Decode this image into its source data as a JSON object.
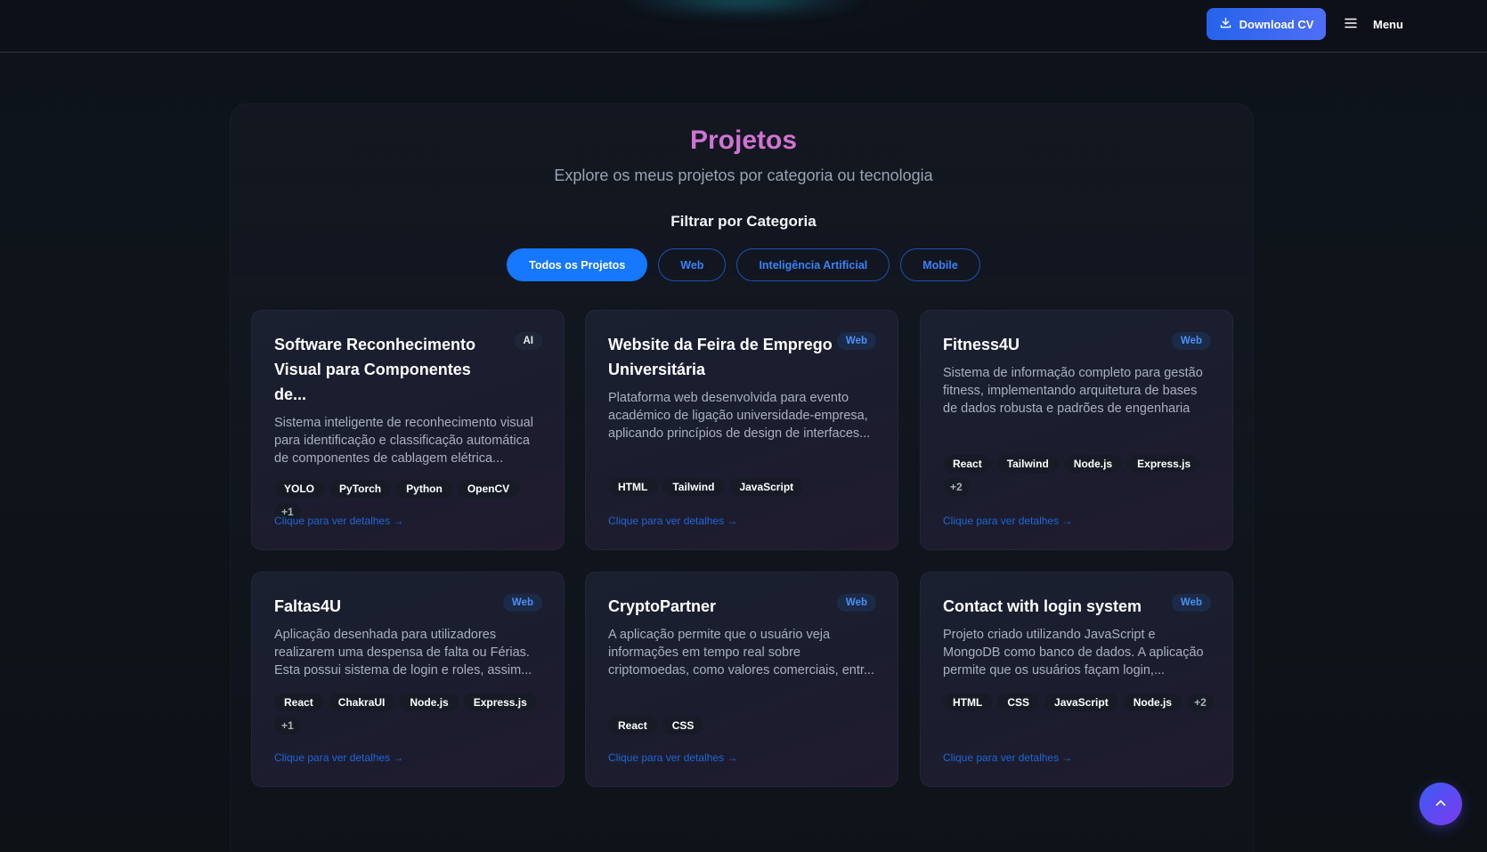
{
  "header": {
    "download_label": "Download CV",
    "menu_label": "Menu"
  },
  "section": {
    "title": "Projetos",
    "subtitle": "Explore os meus projetos por categoria ou tecnologia",
    "filter_heading": "Filtrar por Categoria",
    "filters": [
      {
        "label": "Todos os Projetos",
        "active": true
      },
      {
        "label": "Web",
        "active": false
      },
      {
        "label": "Inteligência Artificial",
        "active": false
      },
      {
        "label": "Mobile",
        "active": false
      }
    ]
  },
  "projects": [
    {
      "title": "Software Reconhecimento Visual para Componentes de...",
      "category": "AI",
      "description": "Sistema inteligente de reconhecimento visual para identificação e classificação automática de componentes de cablagem elétrica...",
      "tags": [
        "YOLO",
        "PyTorch",
        "Python",
        "OpenCV"
      ],
      "more": "+1",
      "link": "Clique para ver detalhes →"
    },
    {
      "title": "Website da Feira de Emprego Universitária",
      "category": "Web",
      "description": "Plataforma web desenvolvida para evento académico de ligação universidade-empresa, aplicando princípios de design de interfaces...",
      "tags": [
        "HTML",
        "Tailwind",
        "JavaScript"
      ],
      "more": "",
      "link": "Clique para ver detalhes →"
    },
    {
      "title": "Fitness4U",
      "category": "Web",
      "description": "Sistema de informação completo para gestão fitness, implementando arquitetura de bases de dados robusta e padrões de engenharia d...",
      "tags": [
        "React",
        "Tailwind",
        "Node.js",
        "Express.js"
      ],
      "more": "+2",
      "link": "Clique para ver detalhes →"
    },
    {
      "title": "Faltas4U",
      "category": "Web",
      "description": "Aplicação desenhada para utilizadores realizarem uma despensa de falta ou Férias. Esta possui sistema de login e roles, assim...",
      "tags": [
        "React",
        "ChakraUI",
        "Node.js",
        "Express.js"
      ],
      "more": "+1",
      "link": "Clique para ver detalhes →"
    },
    {
      "title": "CryptoPartner",
      "category": "Web",
      "description": "A aplicação permite que o usuário veja informações em tempo real sobre criptomoedas, como valores comerciais, entr...",
      "tags": [
        "React",
        "CSS"
      ],
      "more": "",
      "link": "Clique para ver detalhes →"
    },
    {
      "title": "Contact with login system",
      "category": "Web",
      "description": "Projeto criado utilizando JavaScript e MongoDB como banco de dados. A aplicação permite que os usuários façam login,...",
      "tags": [
        "HTML",
        "CSS",
        "JavaScript",
        "Node.js"
      ],
      "more": "+2",
      "link": "Clique para ver detalhes →"
    }
  ]
}
